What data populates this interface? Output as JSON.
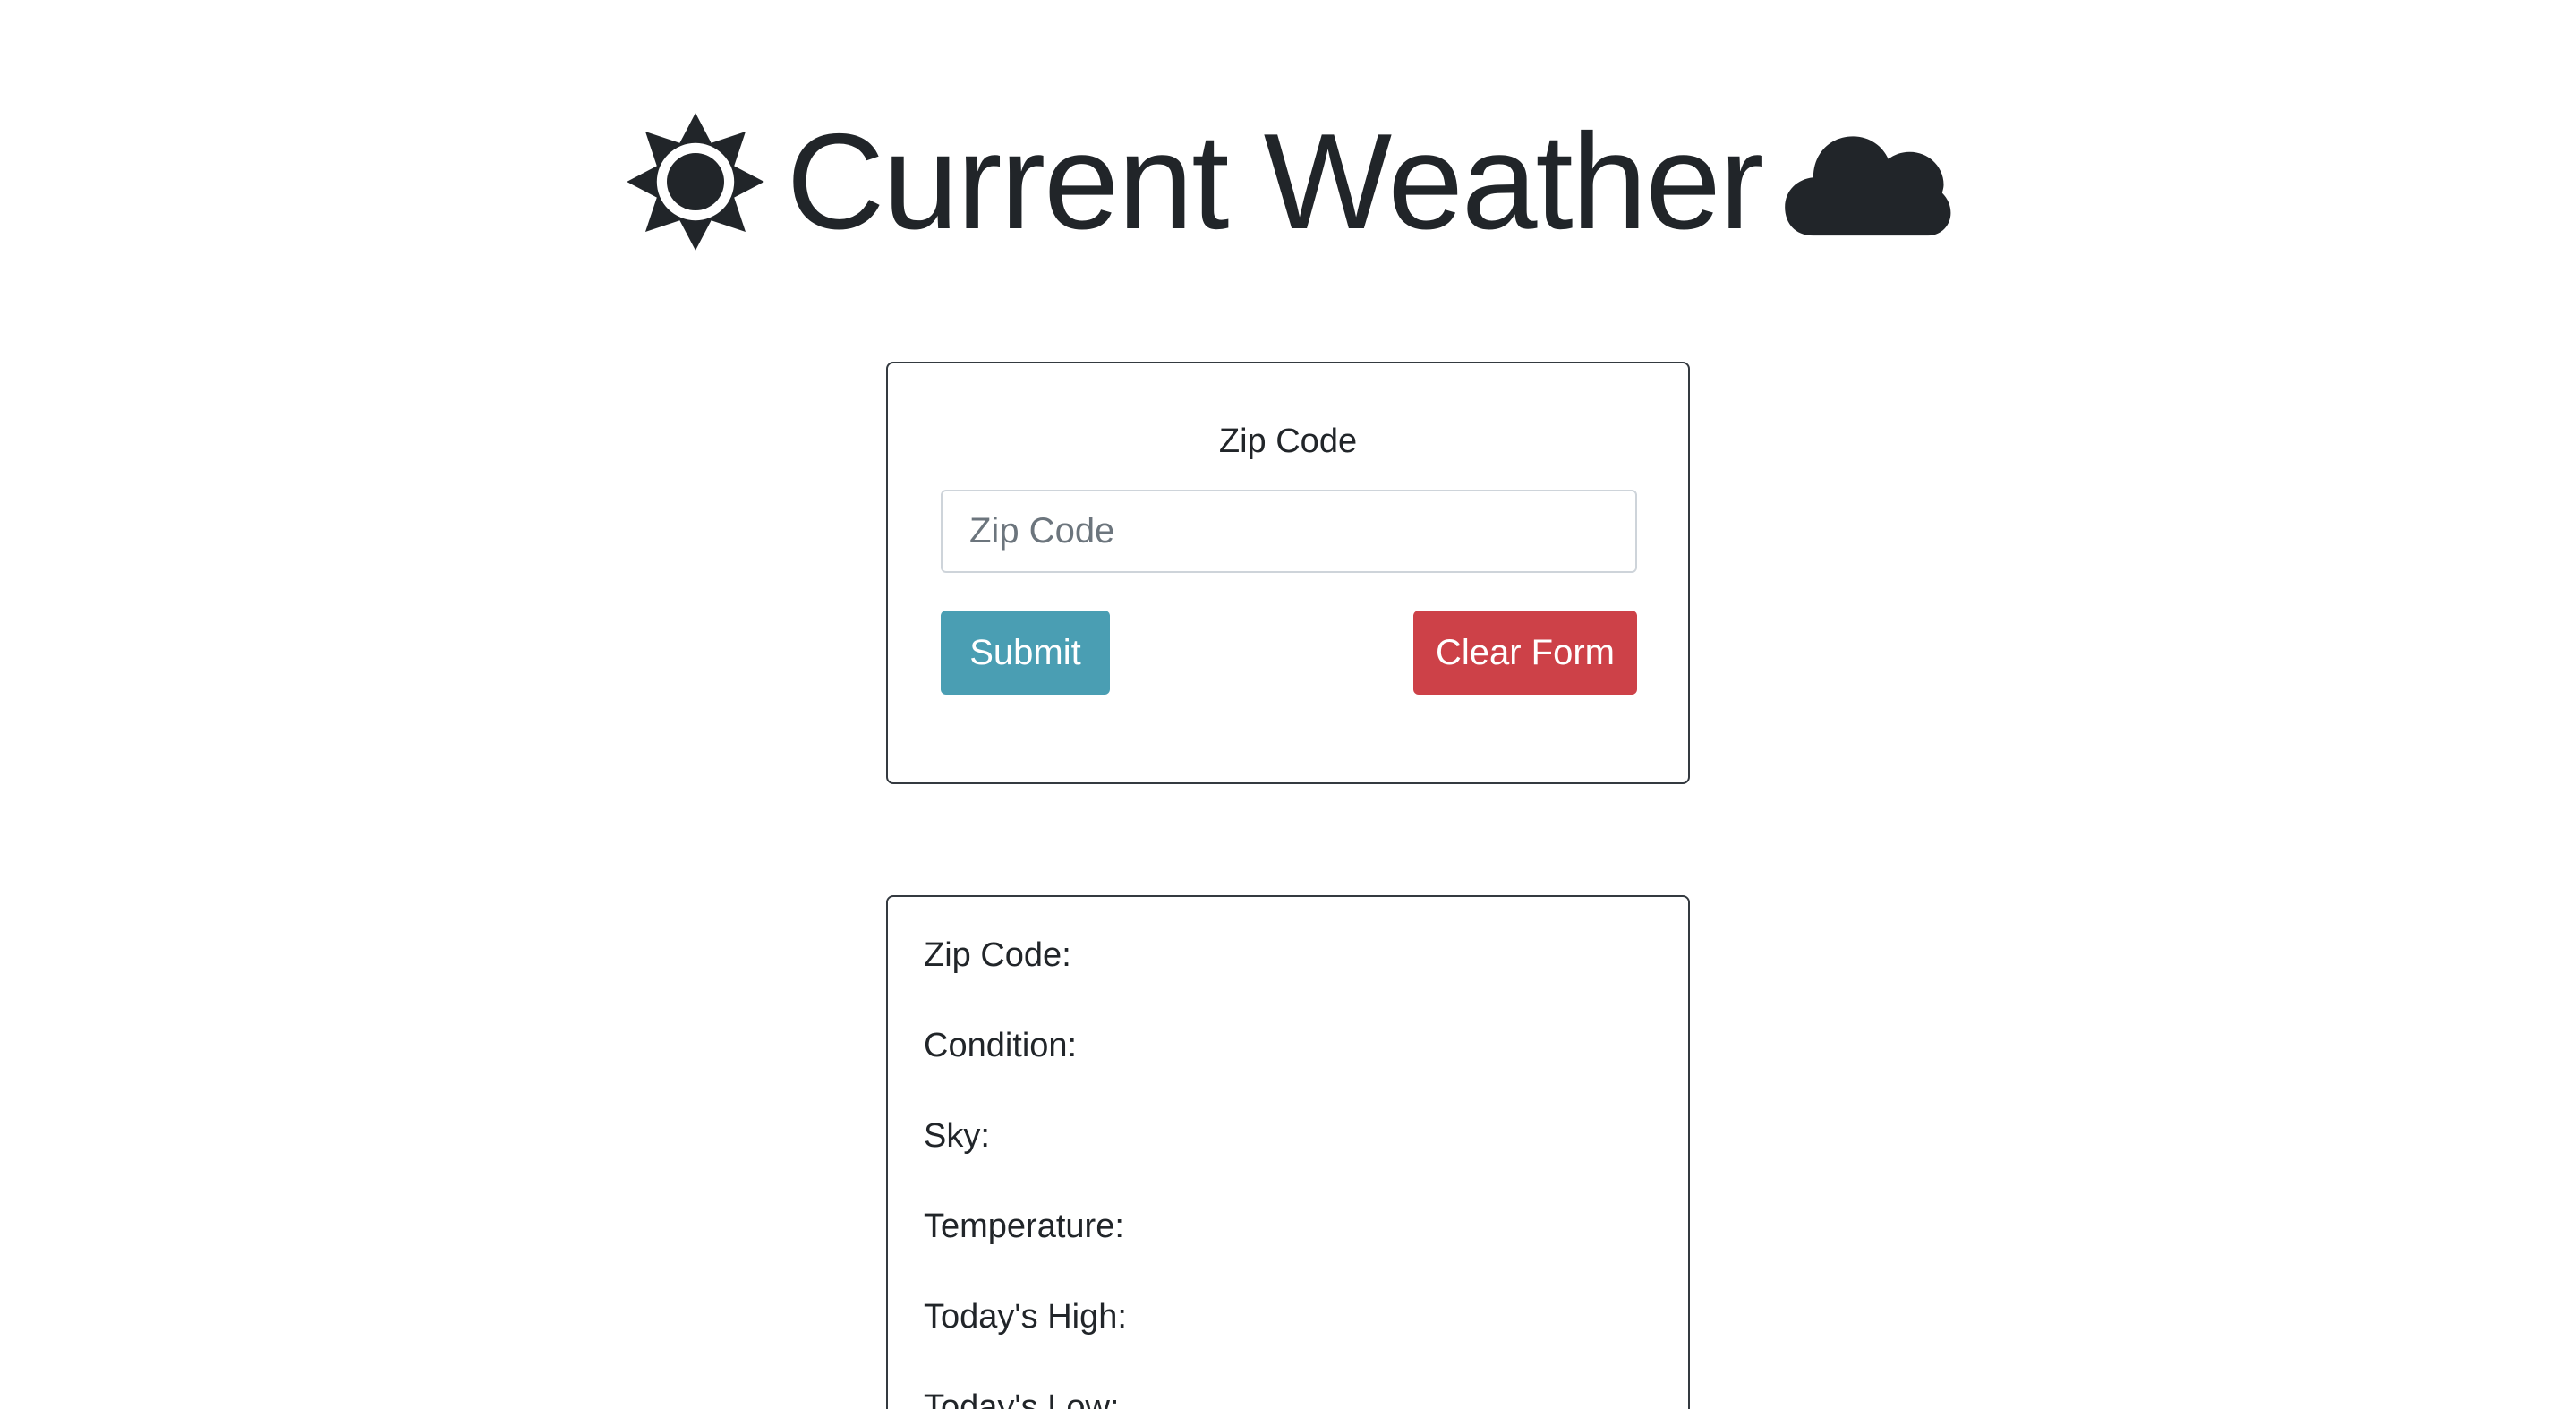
{
  "header": {
    "title": "Current Weather",
    "left_icon": "sun-icon",
    "right_icon": "cloud-icon",
    "icon_color": "#212529"
  },
  "form": {
    "label": "Zip Code",
    "zip_input": {
      "value": "",
      "placeholder": "Zip Code"
    },
    "submit_label": "Submit",
    "clear_label": "Clear Form",
    "submit_color": "#4a9eb3",
    "clear_color": "#cd4148"
  },
  "results": {
    "zip_code_label": "Zip Code:",
    "condition_label": "Condition:",
    "sky_label": "Sky:",
    "temperature_label": "Temperature:",
    "high_label": "Today's High:",
    "low_label": "Today's Low:"
  }
}
